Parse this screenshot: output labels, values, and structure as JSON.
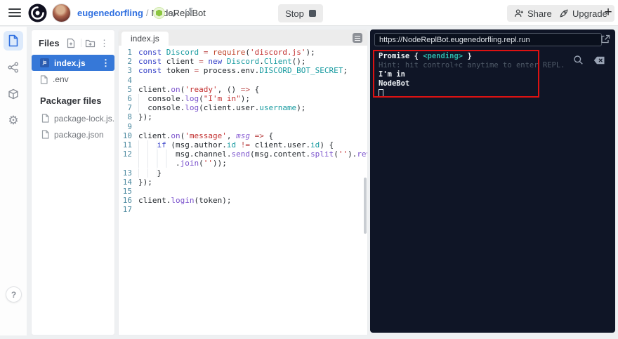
{
  "header": {
    "breadcrumb": {
      "username": "eugenedorfling",
      "separator": "/",
      "project": "NodeReplBot"
    },
    "buttons": {
      "stop": "Stop",
      "share": "Share",
      "upgrade": "Upgrade",
      "new": "+"
    }
  },
  "rail": {
    "help": "?"
  },
  "files_panel": {
    "title": "Files",
    "header_icons": [
      "add-file-icon",
      "add-folder-icon",
      "kebab-menu-icon"
    ],
    "files": [
      {
        "name": "index.js",
        "selected": true,
        "badge": "js"
      },
      {
        "name": ".env",
        "selected": false,
        "badge": ""
      }
    ],
    "packager_title": "Packager files",
    "packager_files": [
      "package-lock.js...",
      "package.json"
    ],
    "kebab_glyph": "⋮"
  },
  "editor": {
    "tab_label": "index.js",
    "lines": [
      {
        "n": "1",
        "indent": 0,
        "tokens": [
          [
            "kw",
            "const"
          ],
          [
            "pl",
            " "
          ],
          [
            "ty",
            "Discord"
          ],
          [
            "pl",
            " "
          ],
          [
            "op",
            "="
          ],
          [
            "pl",
            " "
          ],
          [
            "bi",
            "require"
          ],
          [
            "pl",
            "("
          ],
          [
            "st",
            "'discord.js'"
          ],
          [
            "pl",
            ");"
          ]
        ]
      },
      {
        "n": "2",
        "indent": 0,
        "tokens": [
          [
            "kw",
            "const"
          ],
          [
            "pl",
            " client "
          ],
          [
            "op",
            "="
          ],
          [
            "pl",
            " "
          ],
          [
            "kw",
            "new"
          ],
          [
            "pl",
            " "
          ],
          [
            "ty",
            "Discord"
          ],
          [
            "pl",
            "."
          ],
          [
            "ty",
            "Client"
          ],
          [
            "pl",
            "();"
          ]
        ]
      },
      {
        "n": "3",
        "indent": 0,
        "tokens": [
          [
            "kw",
            "const"
          ],
          [
            "pl",
            " token "
          ],
          [
            "op",
            "="
          ],
          [
            "pl",
            " process.env."
          ],
          [
            "ty",
            "DISCORD_BOT_SECRET"
          ],
          [
            "pl",
            ";"
          ]
        ]
      },
      {
        "n": "4",
        "indent": 0,
        "tokens": []
      },
      {
        "n": "5",
        "indent": 0,
        "tokens": [
          [
            "pl",
            "client."
          ],
          [
            "fn",
            "on"
          ],
          [
            "pl",
            "("
          ],
          [
            "st",
            "'ready'"
          ],
          [
            "pl",
            ", () "
          ],
          [
            "op",
            "=>"
          ],
          [
            "pl",
            " {"
          ]
        ]
      },
      {
        "n": "6",
        "indent": 2,
        "tokens": [
          [
            "pl",
            "console."
          ],
          [
            "fn",
            "log"
          ],
          [
            "pl",
            "("
          ],
          [
            "st",
            "\"I'm in\""
          ],
          [
            "pl",
            ");"
          ]
        ]
      },
      {
        "n": "7",
        "indent": 2,
        "tokens": [
          [
            "pl",
            "console."
          ],
          [
            "fn",
            "log"
          ],
          [
            "pl",
            "(client.user."
          ],
          [
            "ty",
            "username"
          ],
          [
            "pl",
            ");"
          ]
        ]
      },
      {
        "n": "8",
        "indent": 0,
        "tokens": [
          [
            "pl",
            "});"
          ]
        ]
      },
      {
        "n": "9",
        "indent": 0,
        "tokens": []
      },
      {
        "n": "10",
        "indent": 0,
        "tokens": [
          [
            "pl",
            "client."
          ],
          [
            "fn",
            "on"
          ],
          [
            "pl",
            "("
          ],
          [
            "st",
            "'message'"
          ],
          [
            "pl",
            ", "
          ],
          [
            "arg",
            "msg"
          ],
          [
            "pl",
            " "
          ],
          [
            "op",
            "=>"
          ],
          [
            "pl",
            " {"
          ]
        ]
      },
      {
        "n": "11",
        "indent": 4,
        "tokens": [
          [
            "kw",
            "if"
          ],
          [
            "pl",
            " (msg.author."
          ],
          [
            "ty",
            "id"
          ],
          [
            "pl",
            " "
          ],
          [
            "op",
            "!="
          ],
          [
            "pl",
            " client.user."
          ],
          [
            "ty",
            "id"
          ],
          [
            "pl",
            ") {"
          ]
        ]
      },
      {
        "n": "12",
        "indent": 8,
        "tokens": [
          [
            "pl",
            "msg.channel."
          ],
          [
            "fn",
            "send"
          ],
          [
            "pl",
            "(msg.content."
          ],
          [
            "fn",
            "split"
          ],
          [
            "pl",
            "("
          ],
          [
            "st",
            "''"
          ],
          [
            "pl",
            ")."
          ],
          [
            "fn",
            "reverse"
          ],
          [
            "pl",
            "()"
          ]
        ]
      },
      {
        "n": "",
        "indent": 8,
        "tokens": [
          [
            "pl",
            "."
          ],
          [
            "fn",
            "join"
          ],
          [
            "pl",
            "("
          ],
          [
            "st",
            "''"
          ],
          [
            "pl",
            "));"
          ]
        ]
      },
      {
        "n": "13",
        "indent": 4,
        "tokens": [
          [
            "pl",
            "}"
          ]
        ]
      },
      {
        "n": "14",
        "indent": 0,
        "tokens": [
          [
            "pl",
            "});"
          ]
        ]
      },
      {
        "n": "15",
        "indent": 0,
        "tokens": []
      },
      {
        "n": "16",
        "indent": 0,
        "tokens": [
          [
            "pl",
            "client."
          ],
          [
            "fn",
            "login"
          ],
          [
            "pl",
            "(token);"
          ]
        ]
      },
      {
        "n": "17",
        "indent": 0,
        "tokens": []
      }
    ]
  },
  "console": {
    "url": "https://NodeReplBot.eugenedorfling.repl.run",
    "lines": [
      {
        "parts": [
          [
            "bright",
            "Promise { "
          ],
          [
            "teal",
            "<pending>"
          ],
          [
            "bright",
            " }"
          ]
        ]
      },
      {
        "parts": [
          [
            "dim",
            "Hint: hit control+c anytime to enter REPL."
          ]
        ]
      },
      {
        "parts": [
          [
            "bright",
            "I'm in"
          ]
        ]
      },
      {
        "parts": [
          [
            "bright",
            "NodeBot"
          ]
        ]
      },
      {
        "parts": [
          [
            "cursor",
            ""
          ]
        ]
      }
    ]
  },
  "colors": {
    "accent_blue": "#3678d8",
    "breadcrumb_blue": "#2f6fe0",
    "console_bg": "#0f1526",
    "annotation_red": "#dd1212",
    "node_green": "#8bc63f",
    "teal_token": "#189ba0"
  },
  "icons": {
    "kebab": "⋮",
    "history": "↺",
    "gear": "⚙"
  }
}
